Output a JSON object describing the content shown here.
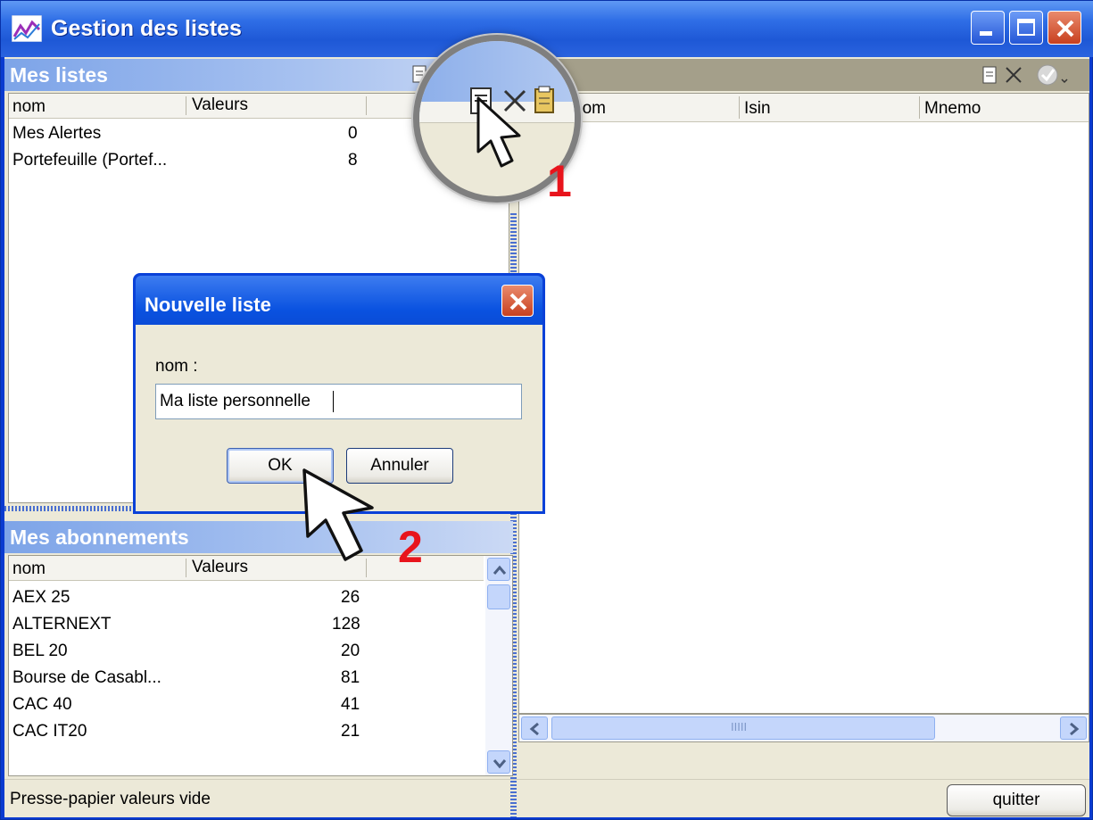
{
  "window": {
    "title": "Gestion des listes"
  },
  "left_top": {
    "header": "Mes listes",
    "columns": [
      "nom",
      "Valeurs"
    ],
    "rows": [
      {
        "name": "Mes Alertes",
        "value": "0"
      },
      {
        "name": "Portefeuille (Portef...",
        "value": "8"
      }
    ]
  },
  "left_bottom": {
    "header": "Mes abonnements",
    "columns": [
      "nom",
      "Valeurs"
    ],
    "rows": [
      {
        "name": "AEX 25",
        "value": "26"
      },
      {
        "name": "ALTERNEXT",
        "value": "128"
      },
      {
        "name": "BEL 20",
        "value": "20"
      },
      {
        "name": "Bourse de Casabl...",
        "value": "81"
      },
      {
        "name": "CAC 40",
        "value": "41"
      },
      {
        "name": "CAC IT20",
        "value": "21"
      }
    ]
  },
  "right": {
    "columns": [
      "nom",
      "Isin",
      "Mnemo"
    ],
    "scroll_grip": "IIIII"
  },
  "dialog": {
    "title": "Nouvelle liste",
    "label": "nom :",
    "input_value": "Ma liste personnelle",
    "ok": "OK",
    "cancel": "Annuler"
  },
  "annotations": {
    "step1": "1",
    "step2": "2"
  },
  "status": {
    "text": "Presse-papier valeurs vide"
  },
  "quit": "quitter",
  "colors": {
    "title_blue": "#2f6ee6",
    "panel_header": "#7da4e8",
    "face": "#ece9d8",
    "red": "#e8141c"
  }
}
